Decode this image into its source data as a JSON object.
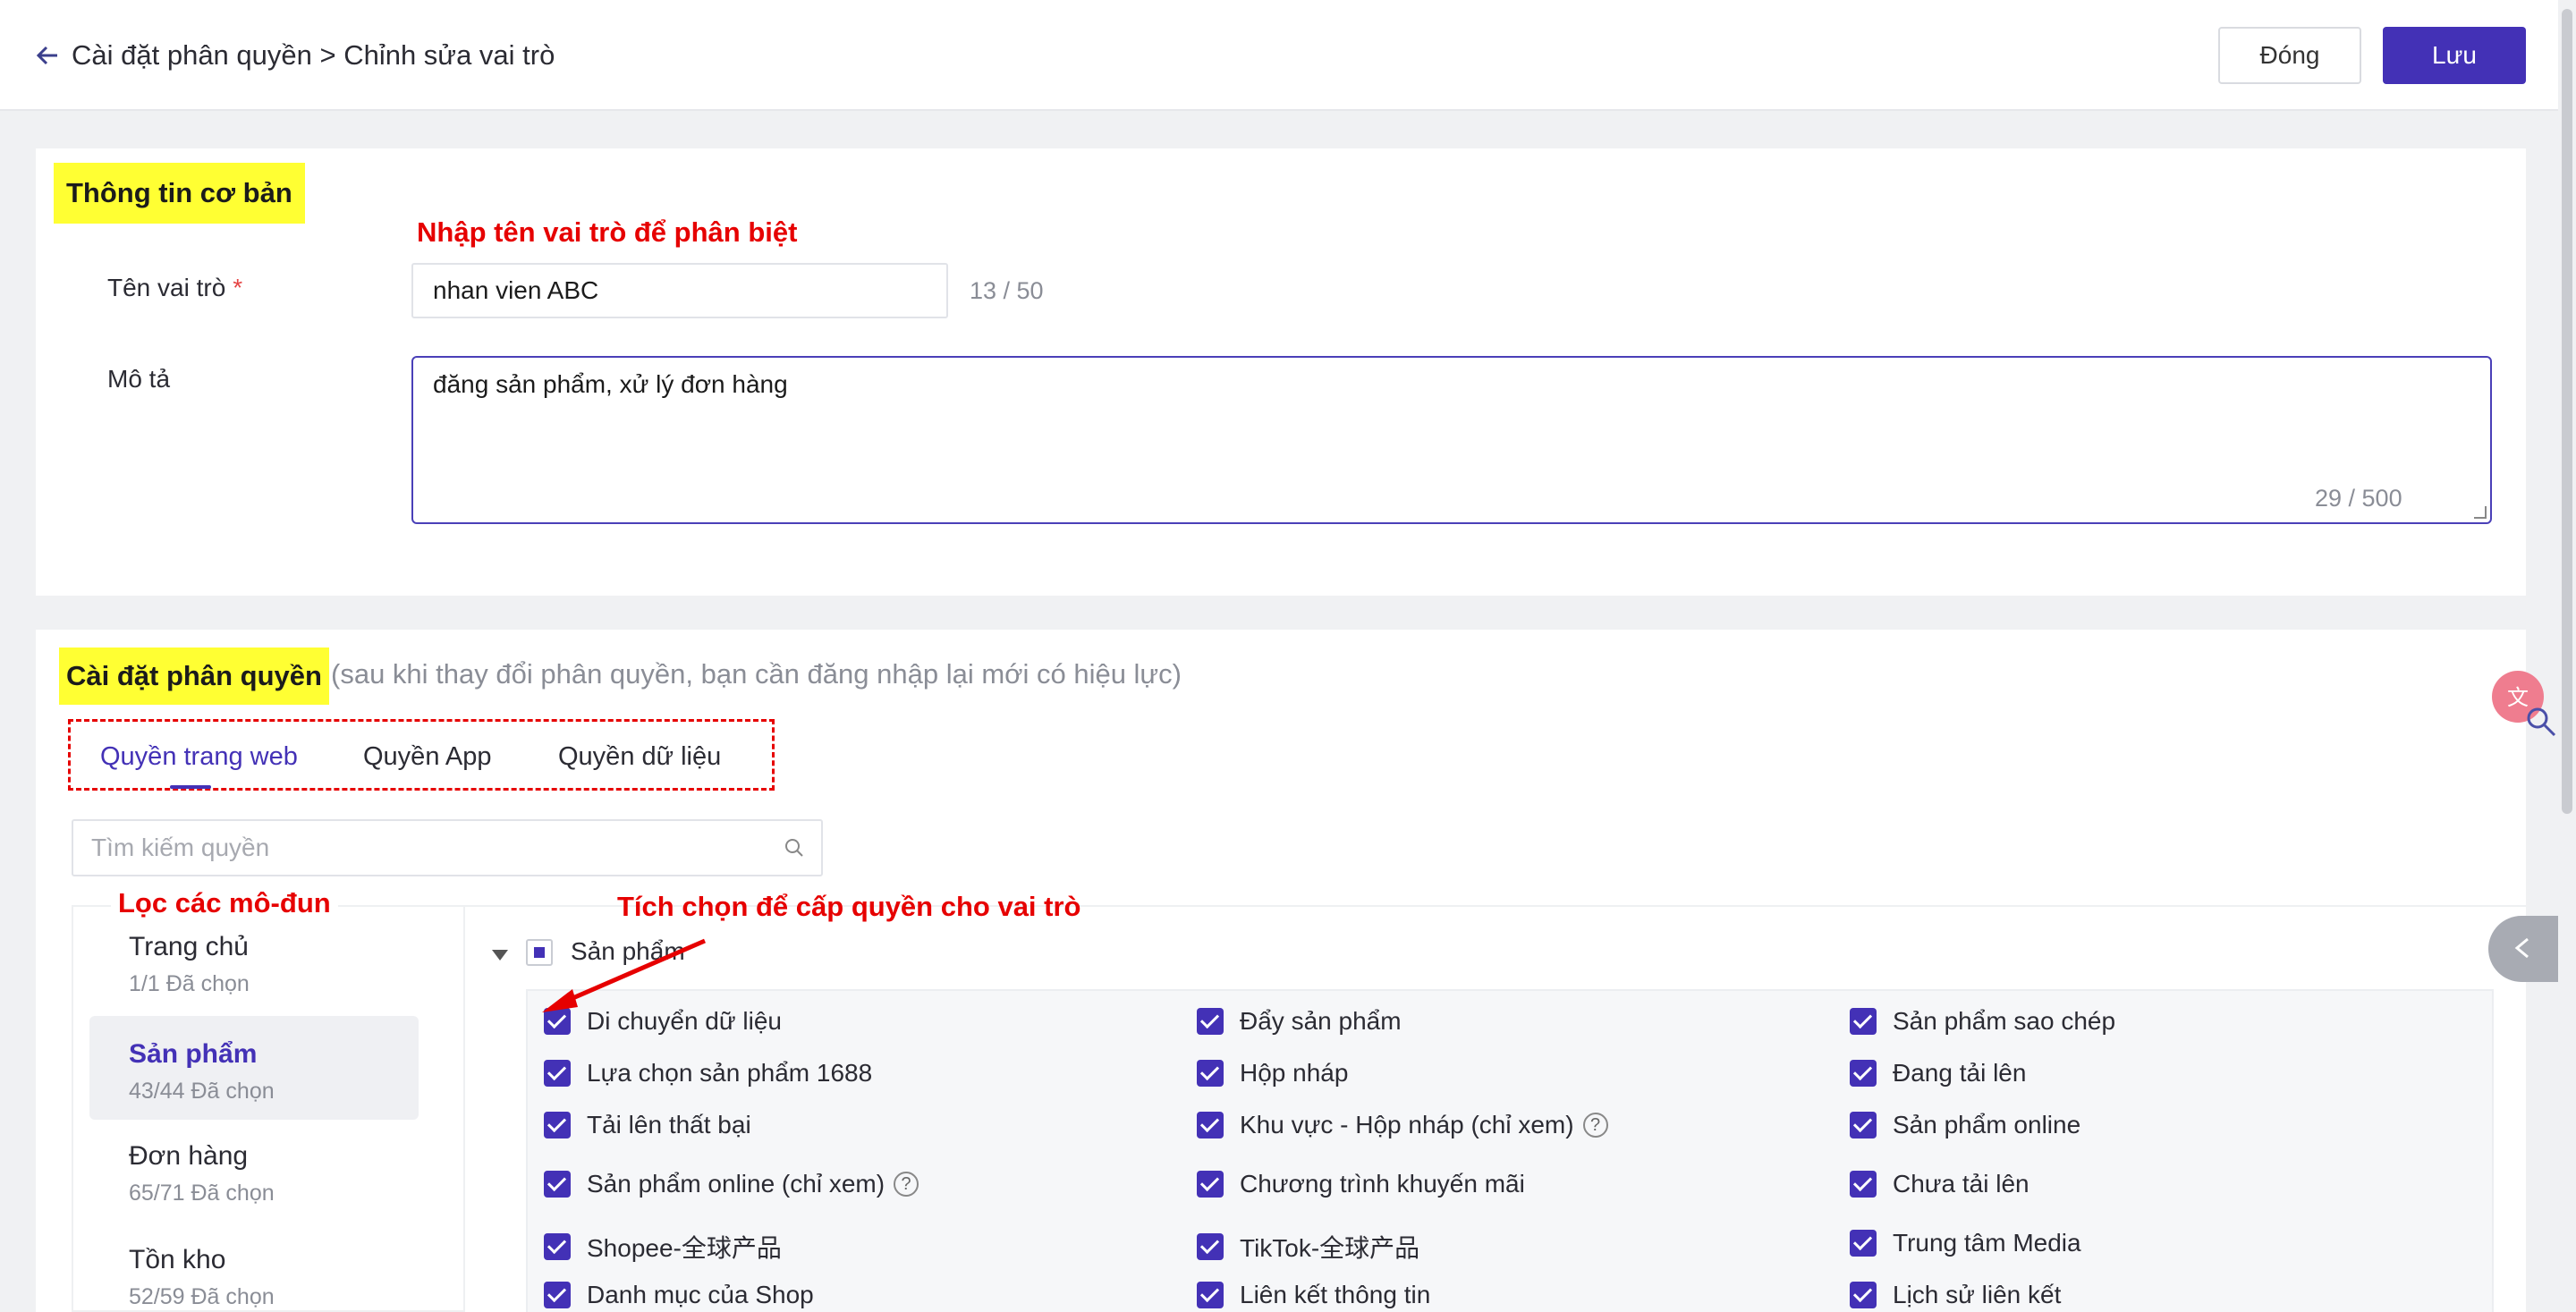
{
  "header": {
    "breadcrumb": "Cài đặt phân quyền > Chỉnh sửa vai trò",
    "close_label": "Đóng",
    "save_label": "Lưu"
  },
  "basic": {
    "title": "Thông tin cơ bản",
    "annotation": "Nhập tên vai trò để phân biệt",
    "name_label": "Tên vai trò",
    "required_mark": "*",
    "name_value": "nhan vien ABC",
    "name_count": "13 / 50",
    "desc_label": "Mô tả",
    "desc_value": "đăng sản phẩm, xử lý đơn hàng",
    "desc_count": "29 / 500"
  },
  "perm": {
    "title": "Cài đặt phân quyền",
    "note": "(sau khi thay đổi phân quyền, bạn cần đăng nhập lại mới có hiệu lực)",
    "tabs": [
      "Quyền trang web",
      "Quyền App",
      "Quyền dữ liệu"
    ],
    "search_placeholder": "Tìm kiếm quyền",
    "annotation_filter": "Lọc các mô-đun",
    "annotation_tick": "Tích chọn để cấp quyền cho vai trò",
    "modules": [
      {
        "title": "Trang chủ",
        "sub": "1/1 Đã chọn"
      },
      {
        "title": "Sản phẩm",
        "sub": "43/44 Đã chọn"
      },
      {
        "title": "Đơn hàng",
        "sub": "65/71 Đã chọn"
      },
      {
        "title": "Tồn kho",
        "sub": "52/59 Đã chọn"
      }
    ],
    "group_title": "Sản phẩm",
    "items": [
      "Di chuyển dữ liệu",
      "Đẩy sản phẩm",
      "Sản phẩm sao chép",
      "Lựa chọn sản phẩm 1688",
      "Hộp nháp",
      "Đang tải lên",
      "Tải lên thất bại",
      "Khu vực - Hộp nháp (chỉ xem)",
      "Sản phẩm online",
      "Sản phẩm online (chỉ xem)",
      "Chương trình khuyến mãi",
      "Chưa tải lên",
      "Shopee-全球产品",
      "TikTok-全球产品",
      "Trung tâm Media",
      "Danh mục của Shop",
      "Liên kết thông tin",
      "Lịch sử liên kết"
    ],
    "help_mark": "?"
  }
}
